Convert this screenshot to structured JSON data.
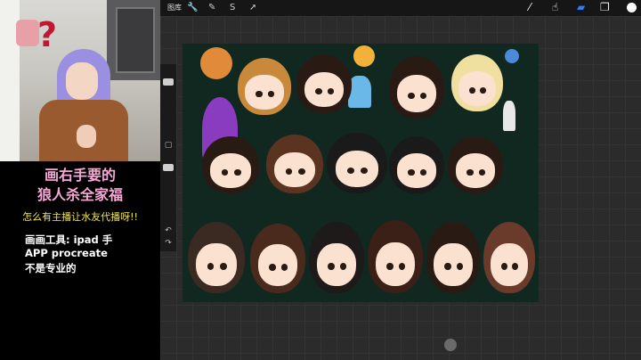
{
  "stream": {
    "logo_mark": "?",
    "title_line1": "画右手要的",
    "title_line2": "狼人杀全家福",
    "subtitle": "怎么有主播让水友代播呀!!",
    "tool_line1": "画画工具: ipad 手",
    "tool_line2": "APP procreate",
    "tool_line3": "不是专业的"
  },
  "procreate": {
    "gallery_label": "图库",
    "left_tools": [
      "wrench-icon",
      "magic-wand-icon",
      "selection-icon",
      "transform-icon"
    ],
    "right_tools": [
      "brush-icon",
      "smudge-icon",
      "eraser-icon",
      "layers-icon",
      "color-icon"
    ],
    "active_tool": "eraser-icon",
    "accent_color": "#2f7cf6",
    "current_color": "#ffffff"
  },
  "artwork": {
    "subject": "chibi group portrait"
  }
}
